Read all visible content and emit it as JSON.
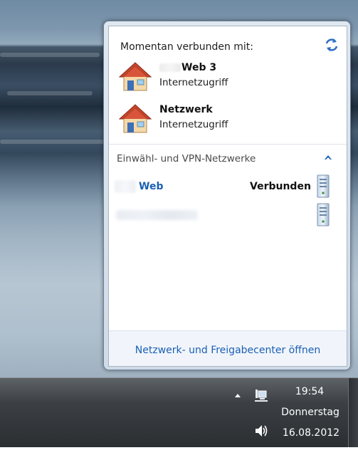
{
  "flyout": {
    "header": "Momentan verbunden mit:",
    "refresh_icon": "refresh-icon",
    "connected": [
      {
        "name": "Web  3",
        "status": "Internetzugriff",
        "icon": "house-icon"
      },
      {
        "name": "Netzwerk",
        "status": "Internetzugriff",
        "icon": "house-icon"
      }
    ],
    "section": {
      "title": "Einwähl- und VPN-Netzwerke",
      "collapse_icon": "chevron-up-icon",
      "items": [
        {
          "name": "Web",
          "status": "Verbunden",
          "icon": "server-icon"
        },
        {
          "name": "",
          "status": "",
          "icon": "server-icon"
        }
      ]
    },
    "footer_link": "Netzwerk- und Freigabecenter öffnen"
  },
  "taskbar": {
    "time": "19:54",
    "day": "Donnerstag",
    "date": "16.08.2012",
    "icons": [
      "show-hidden-icons-arrow",
      "network-icon",
      "volume-icon"
    ]
  },
  "colors": {
    "link": "#1a5fb4",
    "taskbar": "#3c4044",
    "accent_refresh": "#2f6fc4"
  }
}
